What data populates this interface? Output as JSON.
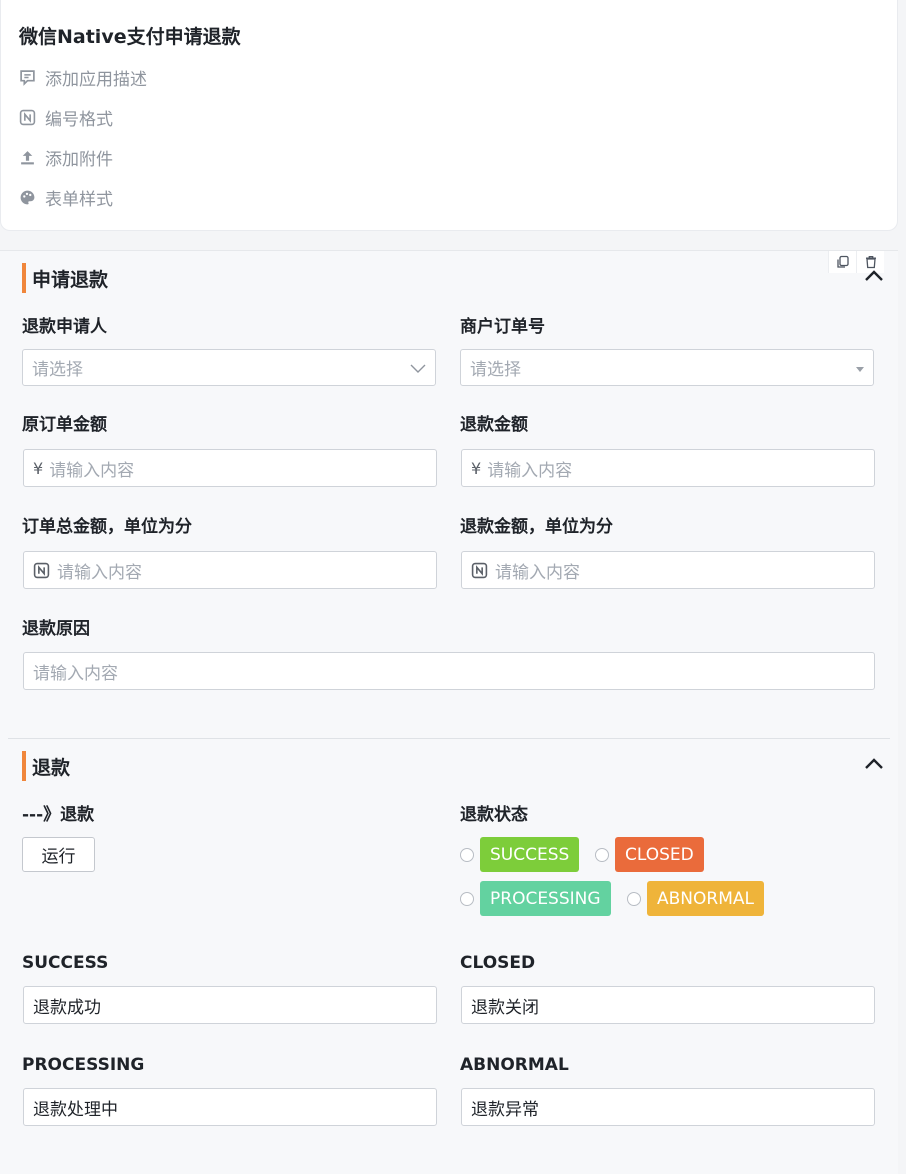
{
  "app": {
    "title": "微信Native支付申请退款",
    "links": [
      {
        "label": "添加应用描述",
        "icon": "comment-icon"
      },
      {
        "label": "编号格式",
        "icon": "number-format-icon"
      },
      {
        "label": "添加附件",
        "icon": "upload-icon"
      },
      {
        "label": "表单样式",
        "icon": "palette-icon"
      }
    ]
  },
  "toolbar": {
    "copy_icon": "copy-icon",
    "delete_icon": "trash-icon"
  },
  "section1": {
    "title": "申请退款",
    "fields": {
      "applicant": {
        "label": "退款申请人",
        "placeholder": "请选择"
      },
      "order_no": {
        "label": "商户订单号",
        "placeholder": "请选择"
      },
      "orig_amount": {
        "label": "原订单金额",
        "prefix": "¥",
        "placeholder": "请输入内容"
      },
      "refund_amount": {
        "label": "退款金额",
        "prefix": "¥",
        "placeholder": "请输入内容"
      },
      "total_fen": {
        "label": "订单总金额，单位为分",
        "placeholder": "请输入内容"
      },
      "refund_fen": {
        "label": "退款金额，单位为分",
        "placeholder": "请输入内容"
      },
      "reason": {
        "label": "退款原因",
        "placeholder": "请输入内容"
      }
    }
  },
  "section2": {
    "title": "退款",
    "run": {
      "label": "---》退款",
      "button": "运行"
    },
    "status": {
      "label": "退款状态",
      "options": [
        {
          "label": "SUCCESS",
          "color": "#7dcd3a"
        },
        {
          "label": "CLOSED",
          "color": "#ea6b3b"
        },
        {
          "label": "PROCESSING",
          "color": "#63d2a0"
        },
        {
          "label": "ABNORMAL",
          "color": "#efb43a"
        }
      ]
    },
    "fields": {
      "success": {
        "label": "SUCCESS",
        "value": "退款成功"
      },
      "closed": {
        "label": "CLOSED",
        "value": "退款关闭"
      },
      "processing": {
        "label": "PROCESSING",
        "value": "退款处理中"
      },
      "abnormal": {
        "label": "ABNORMAL",
        "value": "退款异常"
      }
    }
  }
}
